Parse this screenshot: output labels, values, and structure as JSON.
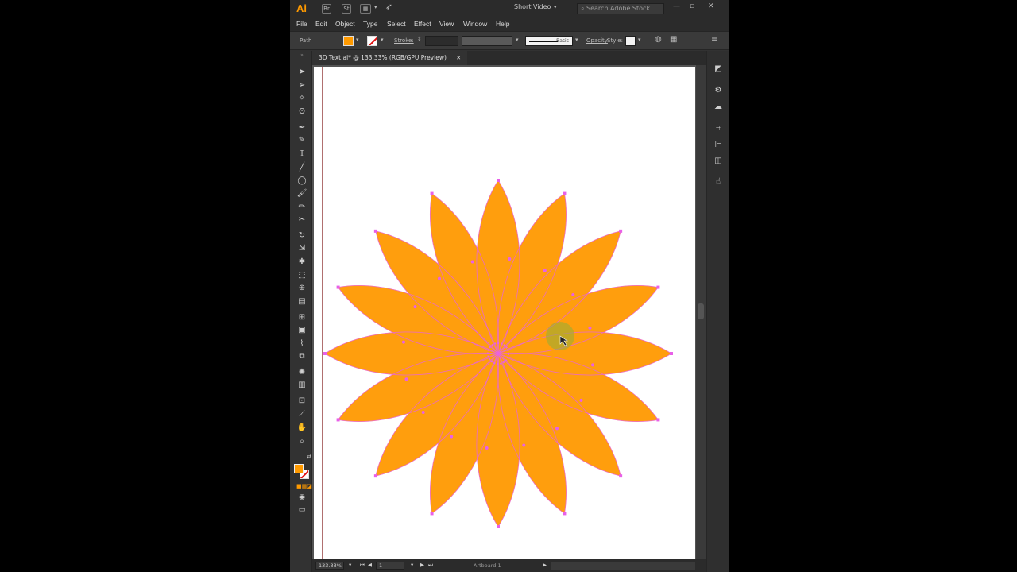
{
  "app": {
    "logo": "Ai",
    "workspace": "Short Video",
    "stock_search_placeholder": "Search Adobe Stock",
    "bridge_label": "Br",
    "stock_label": "St"
  },
  "menu": [
    "File",
    "Edit",
    "Object",
    "Type",
    "Select",
    "Effect",
    "View",
    "Window",
    "Help"
  ],
  "control_bar": {
    "selection_type": "Path",
    "stroke_label": "Stroke:",
    "profile_label": "Basic",
    "opacity_label": "Opacity",
    "style_label": "Style:"
  },
  "document": {
    "tab_title": "3D Text.ai* @ 133.33% (RGB/GPU Preview)",
    "close_glyph": "✕"
  },
  "status_bar": {
    "zoom": "133.33%",
    "artboard_number": "1",
    "artboard_name": "Artboard 1"
  },
  "artwork": {
    "petal_count": 16,
    "fill_color": "#ff9e0d",
    "path_color": "#e860e8"
  },
  "colors": {
    "accent": "#ff9a00",
    "chrome_dark": "#2b2b2b",
    "panel": "#323232"
  }
}
